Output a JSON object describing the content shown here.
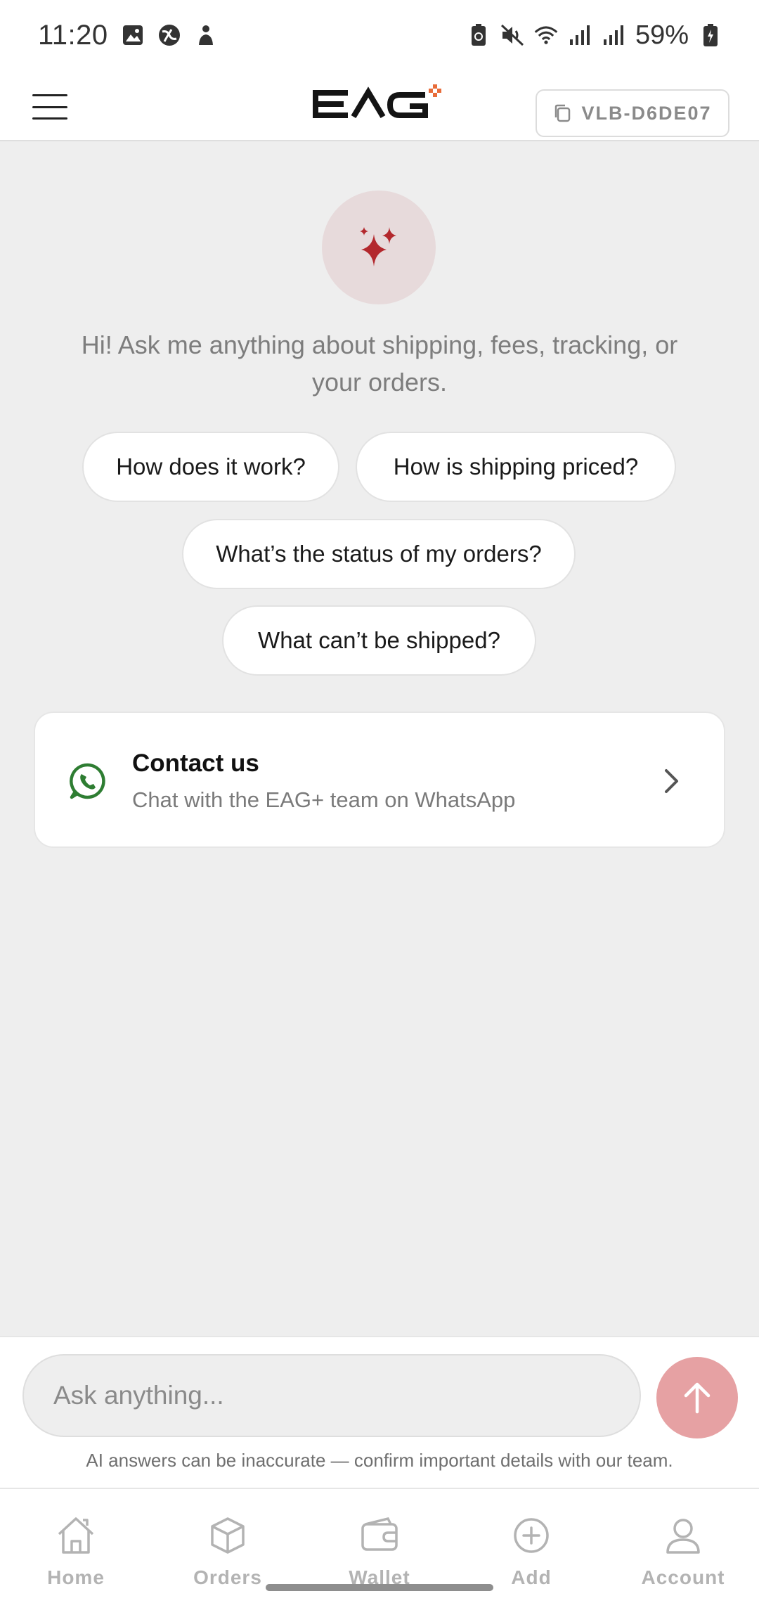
{
  "status_bar": {
    "time": "11:20",
    "battery": "59%",
    "left_icons": [
      "image-icon",
      "globe-icon",
      "person-icon"
    ],
    "right_icons": [
      "battery-saver-icon",
      "mute-icon",
      "wifi-icon",
      "signal-icon",
      "signal-icon",
      "battery-icon"
    ]
  },
  "header": {
    "logo_text": "EAG+",
    "code_chip": "VLB-D6DE07"
  },
  "hero": {
    "greeting": "Hi! Ask me anything about shipping, fees, tracking, or your orders."
  },
  "suggestions": [
    {
      "label": "How does it work?"
    },
    {
      "label": "How is shipping priced?"
    },
    {
      "label": "What’s the status of my orders?"
    },
    {
      "label": "What can’t be shipped?"
    }
  ],
  "contact": {
    "title": "Contact us",
    "subtitle": "Chat with the EAG+ team on WhatsApp"
  },
  "input": {
    "placeholder": "Ask anything...",
    "disclaimer": "AI answers can be inaccurate — confirm important details with our team."
  },
  "nav": {
    "items": [
      {
        "label": "Home",
        "icon": "home-icon"
      },
      {
        "label": "Orders",
        "icon": "box-icon"
      },
      {
        "label": "Wallet",
        "icon": "wallet-icon"
      },
      {
        "label": "Add",
        "icon": "plus-circle-icon"
      },
      {
        "label": "Account",
        "icon": "user-icon"
      }
    ]
  },
  "colors": {
    "accent": "#b3282d",
    "send_button": "#e6a1a3",
    "whatsapp": "#2e7d32",
    "background": "#eeeeee"
  }
}
